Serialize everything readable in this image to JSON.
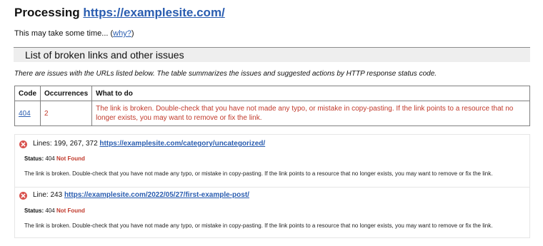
{
  "header": {
    "processing_label": "Processing",
    "site_url": "https://examplesite.com/"
  },
  "progress": {
    "text": "This may take some time... (",
    "why_link": "why?",
    "close_paren": ")"
  },
  "section": {
    "title": "List of broken links and other issues"
  },
  "intro": "There are issues with the URLs listed below. The table summarizes the issues and suggested actions by HTTP response status code.",
  "summary_table": {
    "headers": [
      "Code",
      "Occurrences",
      "What to do"
    ],
    "rows": [
      {
        "code": "404",
        "occurrences": "2",
        "what_to_do": "The link is broken. Double-check that you have not made any typo, or mistake in copy-pasting. If the link points to a resource that no longer exists, you may want to remove or fix the link."
      }
    ]
  },
  "issues": [
    {
      "lines_label": "Lines: 199, 267, 372",
      "url": "https://examplesite.com/category/uncategorized/",
      "status_label": "Status:",
      "status_code": "404",
      "status_text": "Not Found",
      "message": "The link is broken. Double-check that you have not made any typo, or mistake in copy-pasting. If the link points to a resource that no longer exists, you may want to remove or fix the link."
    },
    {
      "lines_label": "Line: 243",
      "url": "https://examplesite.com/2022/05/27/first-example-post/",
      "status_label": "Status:",
      "status_code": "404",
      "status_text": "Not Found",
      "message": "The link is broken. Double-check that you have not made any typo, or mistake in copy-pasting. If the link points to a resource that no longer exists, you may want to remove or fix the link."
    }
  ],
  "colors": {
    "link": "#2a5db0",
    "error": "#c0392b",
    "error_icon": "#d9534f",
    "section_bg": "#eeeeee"
  },
  "icons": {
    "issue_icon": "error-circle-x-icon"
  }
}
